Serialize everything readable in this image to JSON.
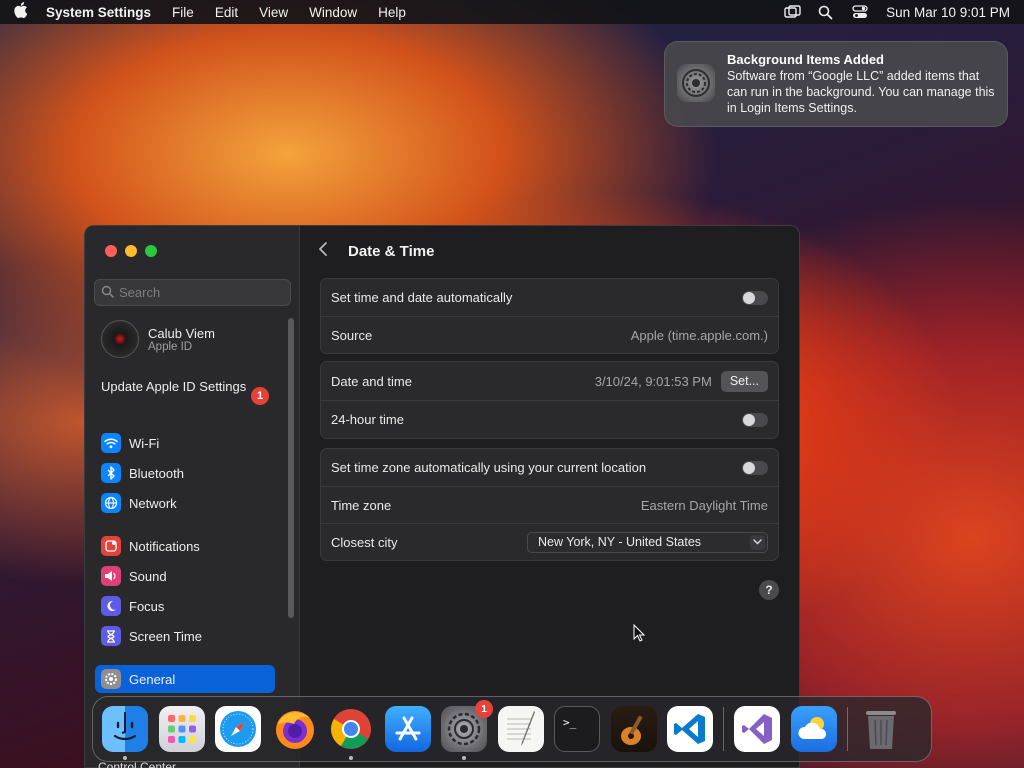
{
  "menubar": {
    "app_name": "System Settings",
    "menus": [
      "File",
      "Edit",
      "View",
      "Window",
      "Help"
    ],
    "clock": "Sun Mar 10  9:01 PM"
  },
  "notification": {
    "title": "Background Items Added",
    "body": "Software from “Google LLC” added items that can run in the background. You can manage this in Login Items Settings."
  },
  "sidebar": {
    "search_placeholder": "Search",
    "account_name": "Calub Viem",
    "account_sub": "Apple ID",
    "update_text": "Update Apple ID Settings",
    "update_badge": "1",
    "items": [
      {
        "label": "Wi-Fi",
        "icon": "wifi-icon",
        "color": "#0a84ff"
      },
      {
        "label": "Bluetooth",
        "icon": "bluetooth-icon",
        "color": "#0a84ff"
      },
      {
        "label": "Network",
        "icon": "network-icon",
        "color": "#0a84ff"
      },
      {
        "label": "Notifications",
        "icon": "notifications-icon",
        "color": "#e5433a"
      },
      {
        "label": "Sound",
        "icon": "sound-icon",
        "color": "#e0407a"
      },
      {
        "label": "Focus",
        "icon": "focus-icon",
        "color": "#5e5ce6"
      },
      {
        "label": "Screen Time",
        "icon": "screen-time-icon",
        "color": "#5e5ce6"
      },
      {
        "label": "General",
        "icon": "gear-icon",
        "color": "#8e8e93",
        "selected": true
      },
      {
        "label": "Control Center",
        "icon": "control-center-icon",
        "color": "#8e8e93"
      }
    ]
  },
  "content": {
    "title": "Date & Time",
    "group1": {
      "auto_time_label": "Set time and date automatically",
      "auto_time_on": false,
      "source_label": "Source",
      "source_value": "Apple (time.apple.com.)"
    },
    "group2": {
      "date_time_label": "Date and time",
      "date_time_value": "3/10/24, 9:01:53 PM",
      "set_button": "Set...",
      "hour24_label": "24-hour time",
      "hour24_on": false
    },
    "group3": {
      "auto_tz_label": "Set time zone automatically using your current location",
      "auto_tz_on": false,
      "tz_label": "Time zone",
      "tz_value": "Eastern Daylight Time",
      "city_label": "Closest city",
      "city_value": "New York, NY - United States"
    },
    "help": "?"
  },
  "dock": {
    "items": [
      {
        "name": "finder",
        "color": "#2f8cf0"
      },
      {
        "name": "launchpad",
        "color": "#e6e6ea"
      },
      {
        "name": "safari",
        "color": "#1d9bf0"
      },
      {
        "name": "firefox",
        "color": "#ff7a1a"
      },
      {
        "name": "chrome",
        "color": "#ffffff"
      },
      {
        "name": "app-store",
        "color": "#1b8cf2"
      },
      {
        "name": "system-settings",
        "color": "#7a7a80",
        "badge": "1"
      },
      {
        "name": "textedit",
        "color": "#f4f4f4"
      },
      {
        "name": "terminal",
        "color": "#1c1c1e"
      },
      {
        "name": "garageband",
        "color": "#3a2a1a"
      },
      {
        "name": "vscode",
        "color": "#ffffff"
      },
      {
        "name": "visual-studio",
        "color": "#ffffff"
      },
      {
        "name": "weather",
        "color": "#2a8cf4"
      },
      {
        "name": "trash",
        "color": "#5a5a60"
      }
    ]
  }
}
